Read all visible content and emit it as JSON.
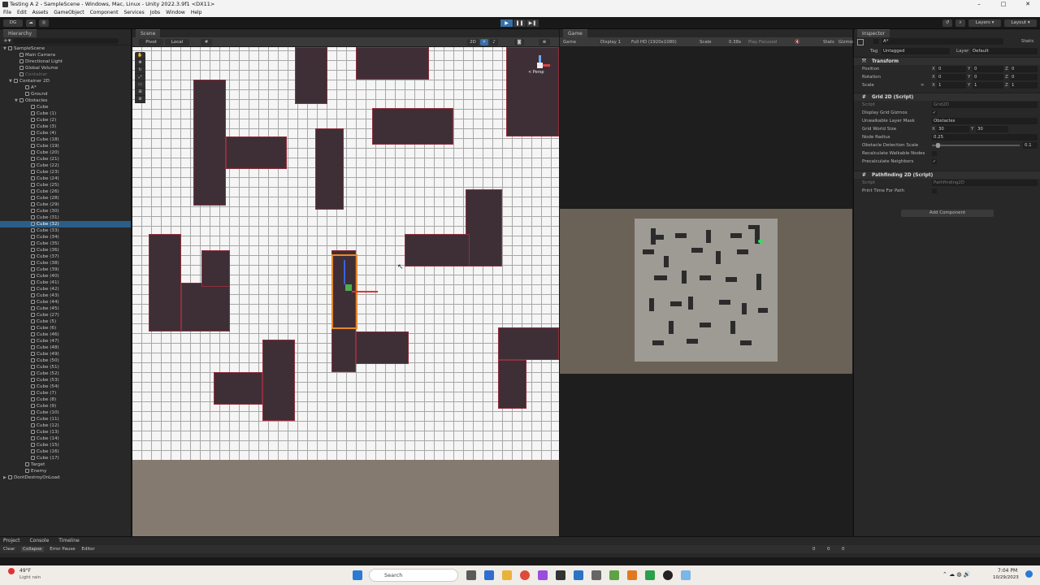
{
  "window": {
    "title": "Testing A 2 - SampleScene - Windows, Mac, Linux - Unity 2022.3.9f1 <DX11>",
    "controls": [
      "–",
      "□",
      "✕"
    ]
  },
  "menu": [
    "File",
    "Edit",
    "Assets",
    "GameObject",
    "Component",
    "Services",
    "Jobs",
    "Window",
    "Help"
  ],
  "toolbar": {
    "account": "DG",
    "layers": "Layers",
    "layout": "Layout",
    "play": "▶",
    "pause": "❚❚",
    "step": "▶❚"
  },
  "hierarchy": {
    "tab": "Hierarchy",
    "rows": [
      {
        "label": "SampleScene",
        "indent": 0,
        "arrow": "▼",
        "kind": "scene"
      },
      {
        "label": "Main Camera",
        "indent": 2
      },
      {
        "label": "Directional Light",
        "indent": 2
      },
      {
        "label": "Global Volume",
        "indent": 2
      },
      {
        "label": "Container",
        "indent": 2,
        "dim": true
      },
      {
        "label": "Container 2D",
        "indent": 1,
        "arrow": "▼"
      },
      {
        "label": "A*",
        "indent": 3
      },
      {
        "label": "Ground",
        "indent": 3
      },
      {
        "label": "Obstacles",
        "indent": 2,
        "arrow": "▼"
      },
      {
        "label": "Cube",
        "indent": 4
      },
      {
        "label": "Cube (1)",
        "indent": 4
      },
      {
        "label": "Cube (2)",
        "indent": 4
      },
      {
        "label": "Cube (3)",
        "indent": 4
      },
      {
        "label": "Cube (4)",
        "indent": 4
      },
      {
        "label": "Cube (18)",
        "indent": 4
      },
      {
        "label": "Cube (19)",
        "indent": 4
      },
      {
        "label": "Cube (20)",
        "indent": 4
      },
      {
        "label": "Cube (21)",
        "indent": 4
      },
      {
        "label": "Cube (22)",
        "indent": 4
      },
      {
        "label": "Cube (23)",
        "indent": 4
      },
      {
        "label": "Cube (24)",
        "indent": 4
      },
      {
        "label": "Cube (25)",
        "indent": 4
      },
      {
        "label": "Cube (26)",
        "indent": 4
      },
      {
        "label": "Cube (28)",
        "indent": 4
      },
      {
        "label": "Cube (29)",
        "indent": 4
      },
      {
        "label": "Cube (30)",
        "indent": 4
      },
      {
        "label": "Cube (31)",
        "indent": 4
      },
      {
        "label": "Cube (32)",
        "indent": 4,
        "selected": true
      },
      {
        "label": "Cube (33)",
        "indent": 4
      },
      {
        "label": "Cube (34)",
        "indent": 4
      },
      {
        "label": "Cube (35)",
        "indent": 4
      },
      {
        "label": "Cube (36)",
        "indent": 4
      },
      {
        "label": "Cube (37)",
        "indent": 4
      },
      {
        "label": "Cube (38)",
        "indent": 4
      },
      {
        "label": "Cube (39)",
        "indent": 4
      },
      {
        "label": "Cube (40)",
        "indent": 4
      },
      {
        "label": "Cube (41)",
        "indent": 4
      },
      {
        "label": "Cube (42)",
        "indent": 4
      },
      {
        "label": "Cube (43)",
        "indent": 4
      },
      {
        "label": "Cube (44)",
        "indent": 4
      },
      {
        "label": "Cube (45)",
        "indent": 4
      },
      {
        "label": "Cube (27)",
        "indent": 4
      },
      {
        "label": "Cube (5)",
        "indent": 4
      },
      {
        "label": "Cube (6)",
        "indent": 4
      },
      {
        "label": "Cube (46)",
        "indent": 4
      },
      {
        "label": "Cube (47)",
        "indent": 4
      },
      {
        "label": "Cube (48)",
        "indent": 4
      },
      {
        "label": "Cube (49)",
        "indent": 4
      },
      {
        "label": "Cube (50)",
        "indent": 4
      },
      {
        "label": "Cube (51)",
        "indent": 4
      },
      {
        "label": "Cube (52)",
        "indent": 4
      },
      {
        "label": "Cube (53)",
        "indent": 4
      },
      {
        "label": "Cube (54)",
        "indent": 4
      },
      {
        "label": "Cube (7)",
        "indent": 4
      },
      {
        "label": "Cube (8)",
        "indent": 4
      },
      {
        "label": "Cube (9)",
        "indent": 4
      },
      {
        "label": "Cube (10)",
        "indent": 4
      },
      {
        "label": "Cube (11)",
        "indent": 4
      },
      {
        "label": "Cube (12)",
        "indent": 4
      },
      {
        "label": "Cube (13)",
        "indent": 4
      },
      {
        "label": "Cube (14)",
        "indent": 4
      },
      {
        "label": "Cube (15)",
        "indent": 4
      },
      {
        "label": "Cube (16)",
        "indent": 4
      },
      {
        "label": "Cube (17)",
        "indent": 4
      },
      {
        "label": "Target",
        "indent": 3
      },
      {
        "label": "Enemy",
        "indent": 3
      },
      {
        "label": "DontDestroyOnLoad",
        "indent": 0,
        "arrow": "▶",
        "kind": "scene"
      }
    ]
  },
  "scene": {
    "tab": "Scene",
    "toolbar_left": [
      "Pivot",
      "Local"
    ],
    "gizmo_label": "< Persp"
  },
  "game": {
    "tab": "Game",
    "mode": "Game",
    "display": "Display 1",
    "resolution": "Full HD (1920x1080)",
    "scale_label": "Scale",
    "scale_value": "0.38x",
    "play_focused": "Play Focused",
    "stats": "Stats",
    "gizmos": "Gizmos"
  },
  "inspector": {
    "tab": "Inspector",
    "object_name": "A*",
    "static_label": "Static",
    "tag_label": "Tag",
    "tag_value": "Untagged",
    "layer_label": "Layer",
    "layer_value": "Default",
    "transform": {
      "title": "Transform",
      "position_label": "Position",
      "position": [
        "0",
        "0",
        "0"
      ],
      "rotation_label": "Rotation",
      "rotation": [
        "0",
        "0",
        "0"
      ],
      "scale_label": "Scale",
      "scale": [
        "1",
        "1",
        "1"
      ]
    },
    "grid": {
      "title": "Grid 2D (Script)",
      "script_label": "Script",
      "script_value": "Grid2D",
      "rows": [
        {
          "label": "Display Grid Gizmos",
          "type": "check",
          "value": "✓"
        },
        {
          "label": "Unwalkable Layer Mask",
          "type": "field",
          "value": "Obstacles"
        },
        {
          "label": "Grid World Size",
          "type": "xy",
          "x": "30",
          "y": "30"
        },
        {
          "label": "Node Radius",
          "type": "field",
          "value": "0.25"
        },
        {
          "label": "Obstacle Detection Scale",
          "type": "slider",
          "value": "0.1",
          "fill": 0.05
        },
        {
          "label": "Recalculate Walkable Nodes",
          "type": "check",
          "value": ""
        },
        {
          "label": "Precalculate Neighbors",
          "type": "check",
          "value": "✓"
        }
      ]
    },
    "pathfinding": {
      "title": "Pathfinding 2D (Script)",
      "script_label": "Script",
      "script_value": "Pathfinding2D",
      "print_label": "Print Time For Path"
    },
    "add_component": "Add Component"
  },
  "bottom": {
    "tabs": [
      "Project",
      "Console",
      "Timeline"
    ],
    "console_buttons": [
      "Clear",
      "Collapse",
      "Error Pause",
      "Editor"
    ],
    "counts": [
      "0",
      "0",
      "0"
    ]
  },
  "taskbar": {
    "weather_temp": "49°F",
    "weather_desc": "Light rain",
    "search": "Search",
    "time": "7:04 PM",
    "date": "10/29/2023"
  },
  "colors": {
    "selection": "#2c5d87",
    "play_active": "#3a6fa8",
    "obstacle_face": "#3e2f36",
    "obstacle_edge": "#8f2f3d",
    "target_green": "#33dd66"
  }
}
